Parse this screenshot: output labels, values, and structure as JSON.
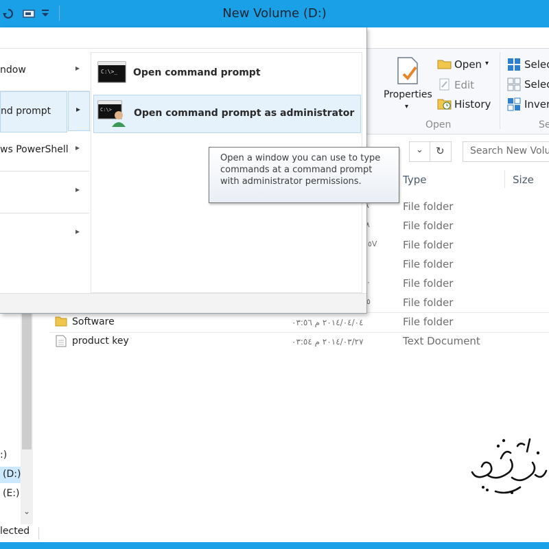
{
  "window": {
    "title": "New Volume (D:)"
  },
  "file_menu": {
    "items": [
      {
        "label": "ndow"
      },
      {
        "label": "nd prompt"
      },
      {
        "label": "ws PowerShell"
      },
      {
        "label": ""
      },
      {
        "label": ""
      }
    ],
    "submenu": [
      {
        "label": "Open command prompt",
        "icon": "cmd-icon"
      },
      {
        "label": "Open command prompt as administrator",
        "icon": "cmd-admin-icon"
      }
    ],
    "tooltip": "Open a window you can use to type commands at a command prompt with administrator permissions."
  },
  "ribbon": {
    "properties_label": "Properties",
    "open_label": "Open",
    "edit_label": "Edit",
    "history_label": "History",
    "open_group_label": "Open",
    "select_all_label": "Selec",
    "select_none_label": "Selec",
    "invert_label": "Invert",
    "select_group_label": "Se"
  },
  "search": {
    "placeholder": "Search New Volu"
  },
  "columns": {
    "type": "Type",
    "size": "Size"
  },
  "files": [
    {
      "name": "",
      "date": "A",
      "type": "File folder"
    },
    {
      "name": "",
      "date": "٨",
      "type": "File folder"
    },
    {
      "name": "",
      "date": "٥V",
      "type": "File folder"
    },
    {
      "name": "",
      "date": "",
      "type": "File folder"
    },
    {
      "name": "",
      "date": "٠",
      "type": "File folder"
    },
    {
      "name": "",
      "date": "٥",
      "type": "File folder"
    },
    {
      "name": "Software",
      "date": "٢٠١٤/٠٤/٠٤ م ٠٣:٥٦",
      "type": "File folder"
    },
    {
      "name": "product key",
      "date": "٢٠١٤/٠٣/٢٧ م ٠٣:٥٤",
      "type": "Text Document"
    }
  ],
  "nav_pane": [
    {
      "label": ":)"
    },
    {
      "label": "(D:)"
    },
    {
      "label": "(E:)"
    }
  ],
  "status": {
    "selected": "lected"
  },
  "colors": {
    "accent": "#1aa0e6",
    "selection": "#e5f1fb"
  }
}
